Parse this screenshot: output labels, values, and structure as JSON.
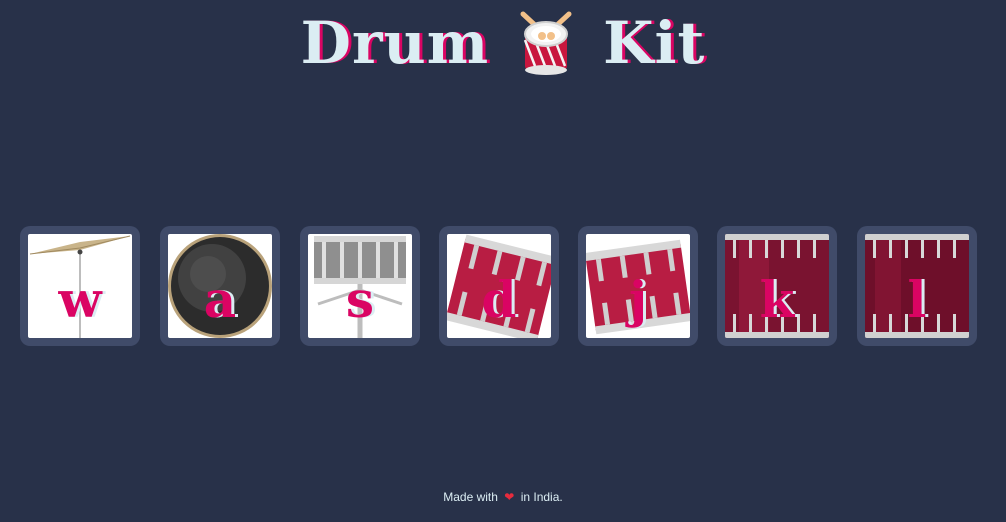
{
  "header": {
    "title_left": "Drum",
    "title_right": "Kit",
    "icon": "drum-icon"
  },
  "keys": [
    {
      "letter": "w",
      "instrument": "crash-cymbal-icon"
    },
    {
      "letter": "a",
      "instrument": "kick-drum-icon"
    },
    {
      "letter": "s",
      "instrument": "snare-drum-icon"
    },
    {
      "letter": "d",
      "instrument": "tom-drum-icon"
    },
    {
      "letter": "j",
      "instrument": "tom-drum-icon"
    },
    {
      "letter": "k",
      "instrument": "floor-tom-icon"
    },
    {
      "letter": "l",
      "instrument": "floor-tom-icon"
    }
  ],
  "footer": {
    "prefix": "Made with",
    "heart": "❤",
    "suffix": "in India."
  },
  "colors": {
    "background": "#283149",
    "key_border": "#404B69",
    "title_text": "#DBEDF3",
    "accent": "#DA0463"
  }
}
